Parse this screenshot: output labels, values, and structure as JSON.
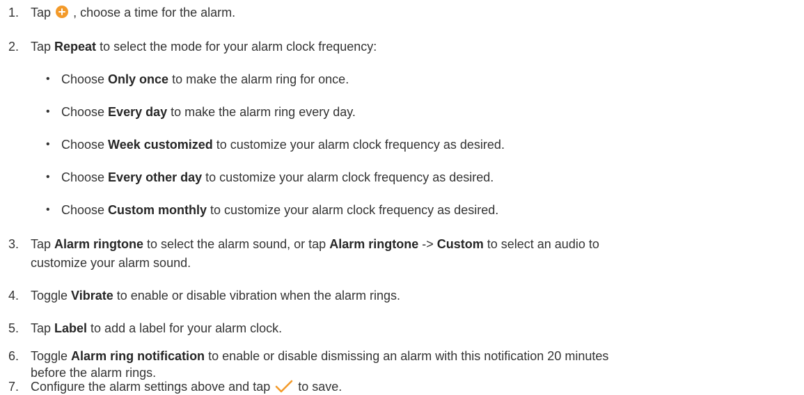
{
  "icons": {
    "plus": "plus-circle-icon",
    "check": "checkmark-icon",
    "accent_color": "#f39a2a"
  },
  "steps": [
    {
      "number": "1.",
      "text_before_icon": "Tap",
      "text_after_icon": ", choose a time for the alarm."
    },
    {
      "number": "2.",
      "text_before": "Tap ",
      "bold": "Repeat",
      "text_after": " to select the mode for your alarm clock frequency:",
      "bullets": [
        {
          "before": "Choose ",
          "bold": "Only once",
          "after": " to make the alarm ring for once."
        },
        {
          "before": "Choose ",
          "bold": "Every day",
          "after": " to make the alarm ring every day."
        },
        {
          "before": "Choose ",
          "bold": "Week customized",
          "after": " to customize your alarm clock frequency as desired."
        },
        {
          "before": "Choose ",
          "bold": "Every other day",
          "after": " to customize your alarm clock frequency as desired."
        },
        {
          "before": "Choose ",
          "bold": "Custom monthly",
          "after": " to customize your alarm clock frequency as desired."
        }
      ]
    },
    {
      "number": "3.",
      "text_before": "Tap ",
      "bold": "Alarm ringtone",
      "text_middle": " to select the alarm sound, or tap ",
      "bold2": "Alarm ringtone",
      "arrow": " -> ",
      "bold3": "Custom",
      "text_after": " to select an audio to",
      "line2": "customize your alarm sound."
    },
    {
      "number": "4.",
      "text_before": "Toggle ",
      "bold": "Vibrate",
      "text_after": " to enable or disable vibration when the alarm rings."
    },
    {
      "number": "5.",
      "text_before": "Tap ",
      "bold": "Label",
      "text_after": " to add a label for your alarm clock."
    },
    {
      "number": "6.",
      "text_before": "Toggle ",
      "bold": "Alarm ring notification",
      "text_after": " to enable or disable dismissing an alarm with this notification 20 minutes",
      "line2": "before the alarm rings."
    },
    {
      "number": "7.",
      "text_before_icon": "Configure the alarm settings above and tap",
      "text_after_icon": "to save."
    }
  ],
  "bullet_char": "•"
}
